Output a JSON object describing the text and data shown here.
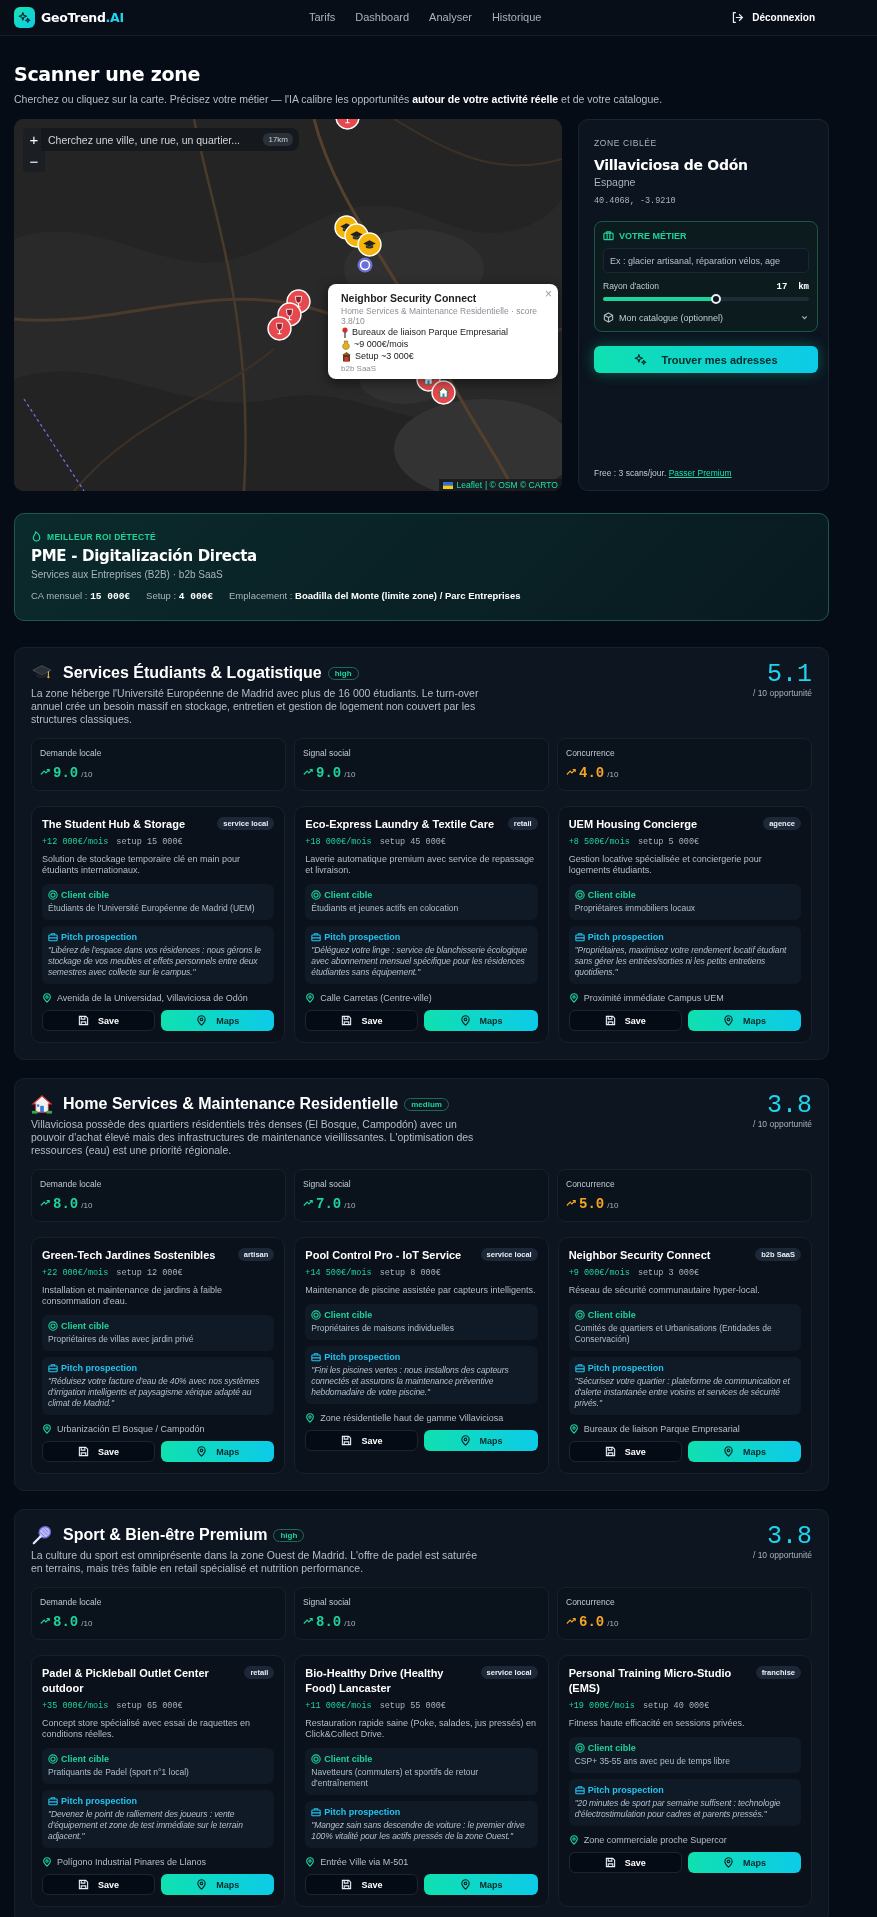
{
  "header": {
    "brand": "GeoTrend",
    "brand_suffix": ".AI",
    "nav": [
      {
        "label": "Tarifs",
        "selected": false
      },
      {
        "label": "Dashboard",
        "selected": false
      },
      {
        "label": "Analyser",
        "selected": false
      },
      {
        "label": "Historique",
        "selected": false
      }
    ],
    "logout": "Déconnexion"
  },
  "intro": {
    "title": "Scanner une zone",
    "subtitle": "Cherchez ou cliquez sur la carte. Précisez votre métier — l'IA calibre les opportunités **autour de votre activité réelle** et de votre catalogue."
  },
  "map": {
    "zoom_in": "+",
    "zoom_out": "−",
    "search_placeholder": "Cherchez une ville, une rue, un quartier...",
    "radius_badge": "17km",
    "markers": [
      {
        "kind": "leisure"
      },
      {
        "kind": "education"
      },
      {
        "kind": "education"
      },
      {
        "kind": "education"
      },
      {
        "kind": "location"
      },
      {
        "kind": "leisure"
      },
      {
        "kind": "leisure"
      },
      {
        "kind": "leisure"
      },
      {
        "kind": "home"
      },
      {
        "kind": "home"
      }
    ],
    "popup": {
      "title": "Neighbor Security Connect",
      "subtitle": "Home Services & Maintenance Residentielle · score 3.8/10",
      "close": "×",
      "lines": [
        {
          "kind": "place",
          "text": "Bureaux de liaison Parque Empresarial"
        },
        {
          "kind": "revenue",
          "text": "~9 000€/mois"
        },
        {
          "kind": "setup",
          "text": "Setup ~3 000€"
        }
      ],
      "tag": "b2b SaaS"
    },
    "attribution_link": "Leaflet",
    "attribution": "| © OSM © CARTO"
  },
  "zone": {
    "label": "ZONE CIBLÉE",
    "name": "Villaviciosa de Odón",
    "country": "Espagne",
    "coords": "40.4068, -3.9210",
    "metier": {
      "title": "VOTRE MÉTIER",
      "placeholder": "Ex : glacier artisanal, réparation vélos, age",
      "radius_label": "Rayon d'action",
      "radius_value": "17",
      "radius_unit": "km",
      "level": 0.55,
      "catalogue": "Mon catalogue (optionnel)"
    },
    "button": "Trouver mes adresses",
    "plan": "Free : 3 scans/jour.",
    "plan_link": "Passer Premium"
  },
  "roi": {
    "label": "MEILLEUR ROI DÉTECTÉ",
    "title": "PME - Digitalización Directa",
    "subtitle": "Services aux Entreprises (B2B) · b2b SaaS",
    "facts": [
      {
        "label": "CA mensuel :",
        "value": "15 000€",
        "kind": "amount"
      },
      {
        "label": "Setup :",
        "value": "4 000€",
        "kind": "amount"
      },
      {
        "label": "Emplacement :",
        "value": "Boadilla del Monte (limite zone) / Parc Entreprises",
        "kind": "place"
      }
    ]
  },
  "sections": [
    {
      "kind": "education",
      "title": "Services Étudiants & Logatistique",
      "badge": "high",
      "description": "La zone héberge l'Université Européenne de Madrid avec plus de 16 000 étudiants. Le turn-over annuel crée un besoin massif en stockage, entretien et gestion de logement non couvert par les structures classiques.",
      "score": "5.1",
      "score_label": "/ 10 opportunité",
      "metrics": [
        {
          "label": "Demande locale",
          "value": "9.0",
          "suffix": "/10",
          "color": "#1ed39a"
        },
        {
          "label": "Signal social",
          "value": "9.0",
          "suffix": "/10",
          "color": "#1ed39a"
        },
        {
          "label": "Concurrence",
          "value": "4.0",
          "suffix": "/10",
          "color": "#f5a524"
        }
      ],
      "cards": [
        {
          "title": "The Student Hub & Storage",
          "tag": "service local",
          "revenue": "+12 000€/mois",
          "setup": "setup 15 000€",
          "description": "Solution de stockage temporaire clé en main pour étudiants internationaux.",
          "client_label": "Client cible",
          "client": "Étudiants de l'Université Européenne de Madrid (UEM)",
          "pitch_label": "Pitch prospection",
          "pitch": "\"Libérez de l'espace dans vos résidences : nous gérons le stockage de vos meubles et effets personnels entre deux semestres avec collecte sur le campus.\"",
          "location": "Avenida de la Universidad, Villaviciosa de Odón",
          "save": "Save",
          "maps": "Maps"
        },
        {
          "title": "Eco-Express Laundry & Textile Care",
          "tag": "retail",
          "revenue": "+18 000€/mois",
          "setup": "setup 45 000€",
          "description": "Laverie automatique premium avec service de repassage et livraison.",
          "client_label": "Client cible",
          "client": "Étudiants et jeunes actifs en colocation",
          "pitch_label": "Pitch prospection",
          "pitch": "\"Déléguez votre linge : service de blanchisserie écologique avec abonnement mensuel spécifique pour les résidences étudiantes sans équipement.\"",
          "location": "Calle Carretas (Centre-ville)",
          "save": "Save",
          "maps": "Maps"
        },
        {
          "title": "UEM Housing Concierge",
          "tag": "agence",
          "revenue": "+8 500€/mois",
          "setup": "setup 5 000€",
          "description": "Gestion locative spécialisée et conciergerie pour logements étudiants.",
          "client_label": "Client cible",
          "client": "Propriétaires immobiliers locaux",
          "pitch_label": "Pitch prospection",
          "pitch": "\"Propriétaires, maximisez votre rendement locatif étudiant sans gérer les entrées/sorties ni les petits entretiens quotidiens.\"",
          "location": "Proximité immédiate Campus UEM",
          "save": "Save",
          "maps": "Maps"
        }
      ]
    },
    {
      "kind": "home",
      "title": "Home Services & Maintenance Residentielle",
      "badge": "medium",
      "description": "Villaviciosa possède des quartiers résidentiels très denses (El Bosque, Campodón) avec un pouvoir d'achat élevé mais des infrastructures de maintenance vieillissantes. L'optimisation des ressources (eau) est une priorité régionale.",
      "score": "3.8",
      "score_label": "/ 10 opportunité",
      "metrics": [
        {
          "label": "Demande locale",
          "value": "8.0",
          "suffix": "/10",
          "color": "#1ed39a"
        },
        {
          "label": "Signal social",
          "value": "7.0",
          "suffix": "/10",
          "color": "#1ed39a"
        },
        {
          "label": "Concurrence",
          "value": "5.0",
          "suffix": "/10",
          "color": "#f5a524"
        }
      ],
      "cards": [
        {
          "title": "Green-Tech Jardines Sostenibles",
          "tag": "artisan",
          "revenue": "+22 000€/mois",
          "setup": "setup 12 000€",
          "description": "Installation et maintenance de jardins à faible consommation d'eau.",
          "client_label": "Client cible",
          "client": "Propriétaires de villas avec jardin privé",
          "pitch_label": "Pitch prospection",
          "pitch": "\"Réduisez votre facture d'eau de 40% avec nos systèmes d'irrigation intelligents et paysagisme xérique adapté au climat de Madrid.\"",
          "location": "Urbanización El Bosque / Campodón",
          "save": "Save",
          "maps": "Maps"
        },
        {
          "title": "Pool Control Pro - IoT Service",
          "tag": "service local",
          "revenue": "+14 500€/mois",
          "setup": "setup 8 000€",
          "description": "Maintenance de piscine assistée par capteurs intelligents.",
          "client_label": "Client cible",
          "client": "Propriétaires de maisons individuelles",
          "pitch_label": "Pitch prospection",
          "pitch": "\"Fini les piscines vertes : nous installons des capteurs connectés et assurons la maintenance préventive hebdomadaire de votre piscine.\"",
          "location": "Zone résidentielle haut de gamme Villaviciosa",
          "save": "Save",
          "maps": "Maps"
        },
        {
          "title": "Neighbor Security Connect",
          "tag": "b2b SaaS",
          "revenue": "+9 000€/mois",
          "setup": "setup 3 000€",
          "description": "Réseau de sécurité communautaire hyper-local.",
          "client_label": "Client cible",
          "client": "Comités de quartiers et Urbanisations (Entidades de Conservación)",
          "pitch_label": "Pitch prospection",
          "pitch": "\"Sécurisez votre quartier : plateforme de communication et d'alerte instantanée entre voisins et services de sécurité privés.\"",
          "location": "Bureaux de liaison Parque Empresarial",
          "save": "Save",
          "maps": "Maps"
        }
      ]
    },
    {
      "kind": "sport",
      "title": "Sport & Bien-être Premium",
      "badge": "high",
      "description": "La culture du sport est omniprésente dans la zone Ouest de Madrid. L'offre de padel est saturée en terrains, mais très faible en retail spécialisé et nutrition performance.",
      "score": "3.8",
      "score_label": "/ 10 opportunité",
      "metrics": [
        {
          "label": "Demande locale",
          "value": "8.0",
          "suffix": "/10",
          "color": "#1ed39a"
        },
        {
          "label": "Signal social",
          "value": "8.0",
          "suffix": "/10",
          "color": "#1ed39a"
        },
        {
          "label": "Concurrence",
          "value": "6.0",
          "suffix": "/10",
          "color": "#f5a524"
        }
      ],
      "cards": [
        {
          "title": "Padel & Pickleball Outlet Center outdoor",
          "tag": "retail",
          "revenue": "+35 000€/mois",
          "setup": "setup 65 000€",
          "description": "Concept store spécialisé avec essai de raquettes en conditions réelles.",
          "client_label": "Client cible",
          "client": "Pratiquants de Padel (sport n°1 local)",
          "pitch_label": "Pitch prospection",
          "pitch": "\"Devenez le point de ralliement des joueurs : vente d'équipement et zone de test immédiate sur le terrain adjacent.\"",
          "location": "Polígono Industrial Pinares de Llanos",
          "save": "Save",
          "maps": "Maps"
        },
        {
          "title": "Bio-Healthy Drive (Healthy Food) Lancaster",
          "tag": "service local",
          "revenue": "+11 000€/mois",
          "setup": "setup 55 000€",
          "description": "Restauration rapide saine (Poke, salades, jus pressés) en Click&Collect Drive.",
          "client_label": "Client cible",
          "client": "Navetteurs (commuters) et sportifs de retour d'entraînement",
          "pitch_label": "Pitch prospection",
          "pitch": "\"Mangez sain sans descendre de voiture : le premier drive 100% vitalité pour les actifs pressés de la zone Ouest.\"",
          "location": "Entrée Ville via M-501",
          "save": "Save",
          "maps": "Maps"
        },
        {
          "title": "Personal Training Micro-Studio (EMS)",
          "tag": "franchise",
          "revenue": "+19 000€/mois",
          "setup": "setup 40 000€",
          "description": "Fitness haute efficacité en sessions privées.",
          "client_label": "Client cible",
          "client": "CSP+ 35-55 ans avec peu de temps libre",
          "pitch_label": "Pitch prospection",
          "pitch": "\"20 minutes de sport par semaine suffisent : technologie d'électrostimulation pour cadres et parents pressés.\"",
          "location": "Zone commerciale proche Supercor",
          "save": "Save",
          "maps": "Maps"
        }
      ]
    }
  ]
}
